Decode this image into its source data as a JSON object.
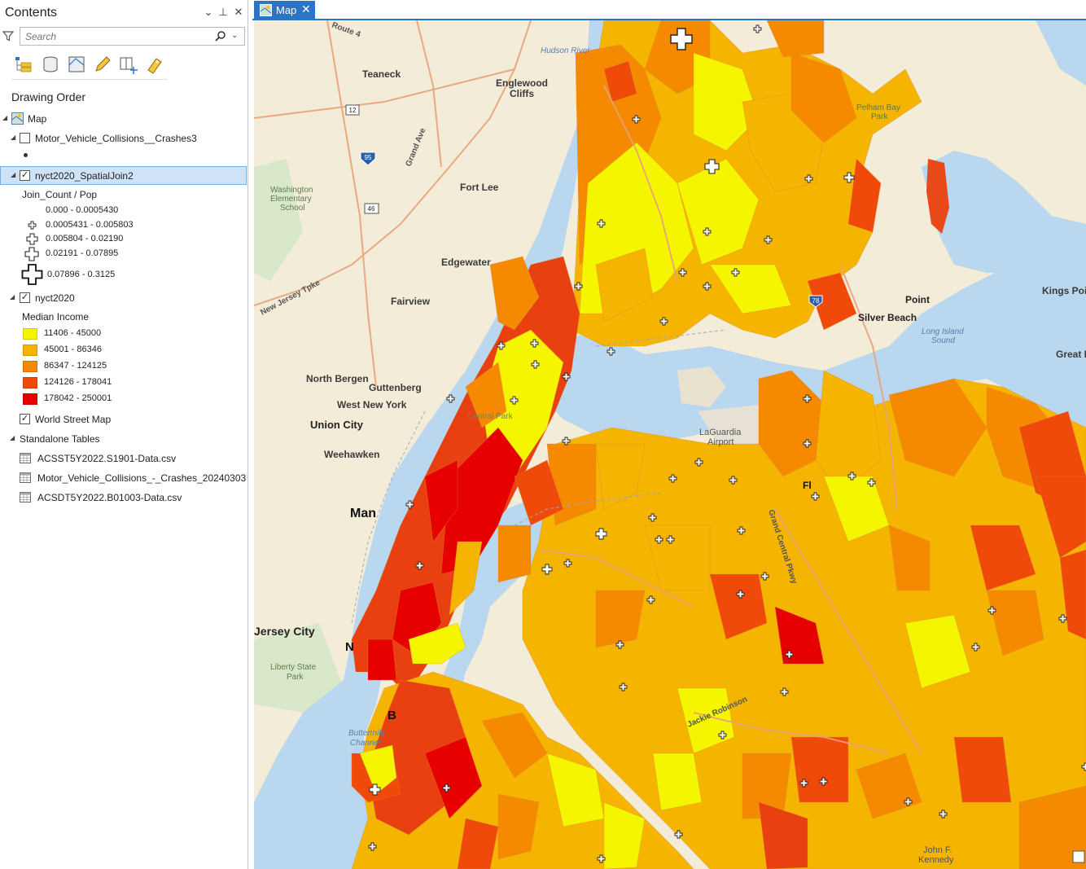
{
  "contents": {
    "title": "Contents",
    "search_placeholder": "Search",
    "drawing_order": "Drawing Order",
    "map_label": "Map",
    "layers": {
      "collisions": {
        "name": "Motor_Vehicle_Collisions__Crashes3",
        "checked": false
      },
      "spatial_join": {
        "name": "nyct2020_SpatialJoin2",
        "checked": true,
        "field": "Join_Count / Pop",
        "classes": [
          "0.000 - 0.0005430",
          "0.0005431 - 0.005803",
          "0.005804 - 0.02190",
          "0.02191 - 0.07895",
          "0.07896 - 0.3125"
        ]
      },
      "nyct": {
        "name": "nyct2020",
        "checked": true,
        "field": "Median Income",
        "classes": [
          {
            "label": "11406 - 45000",
            "color": "#f5f500"
          },
          {
            "label": "45001 - 86346",
            "color": "#f5b400"
          },
          {
            "label": "86347 - 124125",
            "color": "#f58a00"
          },
          {
            "label": "124126 - 178041",
            "color": "#f04a0a"
          },
          {
            "label": "178042 - 250001",
            "color": "#e60000"
          }
        ]
      },
      "basemap": {
        "name": "World Street Map",
        "checked": true
      }
    },
    "standalone_tables": {
      "title": "Standalone Tables",
      "items": [
        "ACSST5Y2022.S1901-Data.csv",
        "Motor_Vehicle_Collisions_-_Crashes_20240303.csv",
        "ACSDT5Y2022.B01003-Data.csv"
      ]
    }
  },
  "map_tab": {
    "label": "Map"
  },
  "map_labels": {
    "teaneck": "Teaneck",
    "englewood_cliffs_1": "Englewood",
    "englewood_cliffs_2": "Cliffs",
    "fort_lee": "Fort Lee",
    "washington_school_1": "Washington",
    "washington_school_2": "Elementary",
    "washington_school_3": "School",
    "edgewater": "Edgewater",
    "fairview": "Fairview",
    "north_bergen": "North Bergen",
    "guttenberg": "Guttenberg",
    "west_new_york": "West New York",
    "union_city": "Union City",
    "weehawken": "Weehawken",
    "jersey_city": "Jersey City",
    "liberty_park_1": "Liberty State",
    "liberty_park_2": "Park",
    "hudson_river": "Hudson River",
    "pelham_bay_1": "Pelham Bay",
    "pelham_bay_2": "Park",
    "point": "Point",
    "silver_beach": "Silver Beach",
    "li_sound_1": "Long Island",
    "li_sound_2": "Sound",
    "kings_point": "Kings Poi",
    "great_neck": "Great N",
    "laguardia_1": "LaGuardia",
    "laguardia_2": "Airport",
    "manhattan_abbr": "Man",
    "n_abbr": "N",
    "b_abbr": "B",
    "fl_abbr": "Fl",
    "buttermilk_1": "Buttermilk",
    "buttermilk_2": "Channel",
    "jfk_1": "John F.",
    "jfk_2": "Kennedy",
    "new_jersey_tpke": "New Jersey Tpke",
    "route_4": "Route 4",
    "grand_ave": "Grand Ave",
    "jackie_robinson": "Jackie Robinson",
    "grand_central": "Grand Central Pkwy",
    "route_12": "12",
    "route_95": "95",
    "route_46": "46",
    "route_78": "78",
    "central_park": "Central Park"
  }
}
